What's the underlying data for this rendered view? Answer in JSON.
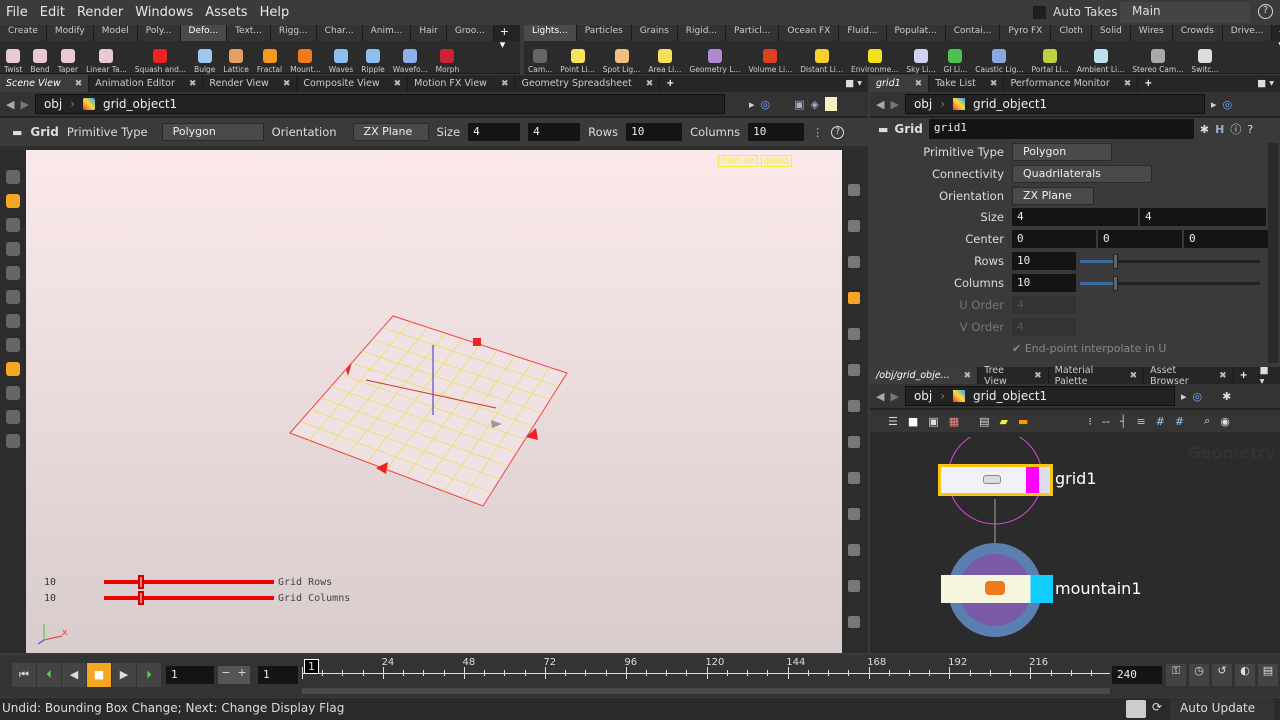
{
  "menubar": {
    "items": [
      "File",
      "Edit",
      "Render",
      "Windows",
      "Assets",
      "Help"
    ],
    "auto_takes": "Auto Takes",
    "take": "Main"
  },
  "shelf_left": {
    "tabs": [
      "Create",
      "Modify",
      "Model",
      "Poly...",
      "Defo...",
      "Text...",
      "Rigg...",
      "Char...",
      "Anim...",
      "Hair",
      "Groo..."
    ],
    "active_tab": 4,
    "tools": [
      {
        "label": "Twist",
        "color": "#e9c9d6"
      },
      {
        "label": "Bend",
        "color": "#e9c9d6"
      },
      {
        "label": "Taper",
        "color": "#e9c9d6"
      },
      {
        "label": "Linear Ta...",
        "color": "#e9c9d6"
      },
      {
        "label": "Squash and...",
        "color": "#e22"
      },
      {
        "label": "Bulge",
        "color": "#9cc8ee"
      },
      {
        "label": "Lattice",
        "color": "#e8a060"
      },
      {
        "label": "Fractal",
        "color": "#f39a1a"
      },
      {
        "label": "Mount...",
        "color": "#f07a1a"
      },
      {
        "label": "Waves",
        "color": "#8cc0ee"
      },
      {
        "label": "Ripple",
        "color": "#8cc0ee"
      },
      {
        "label": "Wavefo...",
        "color": "#8cb0ee"
      },
      {
        "label": "Morph",
        "color": "#cc2233"
      }
    ]
  },
  "shelf_right": {
    "tabs": [
      "Lights...",
      "Particles",
      "Grains",
      "Rigid...",
      "Particl...",
      "Ocean FX",
      "Fluid...",
      "Populat...",
      "Contai...",
      "Pyro FX",
      "Cloth",
      "Solid",
      "Wires",
      "Crowds",
      "Drive..."
    ],
    "active_tab": 0,
    "tools": [
      {
        "label": "Cam...",
        "color": "#666"
      },
      {
        "label": "Point Li...",
        "color": "#f7e45a"
      },
      {
        "label": "Spot Lig...",
        "color": "#f0c080"
      },
      {
        "label": "Area Li...",
        "color": "#f5e05a"
      },
      {
        "label": "Geometry L...",
        "color": "#b08ad0"
      },
      {
        "label": "Volume Li...",
        "color": "#e04020"
      },
      {
        "label": "Distant Li...",
        "color": "#f5d030"
      },
      {
        "label": "Environme...",
        "color": "#f5e020"
      },
      {
        "label": "Sky Li...",
        "color": "#d0d0f0"
      },
      {
        "label": "GI Li...",
        "color": "#50c050"
      },
      {
        "label": "Caustic Lig...",
        "color": "#8aa8e0"
      },
      {
        "label": "Portal Li...",
        "color": "#c0d040"
      },
      {
        "label": "Ambient Li...",
        "color": "#c0e0f0"
      },
      {
        "label": "Stereo Cam...",
        "color": "#aaa"
      },
      {
        "label": "Switc...",
        "color": "#ddd"
      }
    ]
  },
  "left_pane": {
    "tabs": [
      "Scene View",
      "Animation Editor",
      "Render View",
      "Composite View",
      "Motion FX View",
      "Geometry Spreadsheet"
    ],
    "path": {
      "root": "obj",
      "node": "grid_object1"
    },
    "toolbar": {
      "node_type": "Grid",
      "primitive_type_label": "Primitive Type",
      "primitive_type": "Polygon",
      "orientation_label": "Orientation",
      "orientation": "ZX Plane",
      "size_label": "Size",
      "size": [
        "4",
        "4"
      ],
      "rows_label": "Rows",
      "rows": "10",
      "columns_label": "Columns",
      "columns": "10"
    },
    "viewport": {
      "camera_menu": "persp",
      "cam_menu": "no cam",
      "handles": [
        {
          "value": "10",
          "label": "Grid Rows",
          "fraction": 0.2
        },
        {
          "value": "10",
          "label": "Grid Columns",
          "fraction": 0.2
        }
      ],
      "axis_x": "x"
    }
  },
  "params": {
    "tabs": [
      "grid1",
      "Take List",
      "Performance Monitor"
    ],
    "path": {
      "root": "obj",
      "node": "grid_object1"
    },
    "node_type": "Grid",
    "node_name": "grid1",
    "rows": [
      {
        "label": "Primitive Type",
        "value": "Polygon"
      },
      {
        "label": "Connectivity",
        "value": "Quadrilaterals"
      },
      {
        "label": "Orientation",
        "value": "ZX Plane"
      },
      {
        "label": "Size",
        "values": [
          "4",
          "4"
        ]
      },
      {
        "label": "Center",
        "values": [
          "0",
          "0",
          "0"
        ]
      },
      {
        "label": "Rows",
        "value": "10",
        "fraction": 0.2
      },
      {
        "label": "Columns",
        "value": "10",
        "fraction": 0.2
      },
      {
        "label": "U Order",
        "value": "4"
      },
      {
        "label": "V Order",
        "value": "4"
      }
    ],
    "endpoint": "End-point interpolate in U"
  },
  "network": {
    "tabs": [
      "/obj/grid_obje...",
      "Tree View",
      "Material Palette",
      "Asset Browser"
    ],
    "path": {
      "root": "obj",
      "node": "grid_object1"
    },
    "watermark": "Geometry",
    "nodes": [
      {
        "name": "grid1"
      },
      {
        "name": "mountain1"
      }
    ]
  },
  "timeline": {
    "frame": "1",
    "start": "1",
    "current": "1",
    "end": "240",
    "ticks": [
      "24",
      "48",
      "72",
      "96",
      "120",
      "144",
      "168",
      "192",
      "216"
    ]
  },
  "status": {
    "message": "Undid: Bounding Box Change; Next: Change Display Flag",
    "auto_update": "Auto Update"
  }
}
